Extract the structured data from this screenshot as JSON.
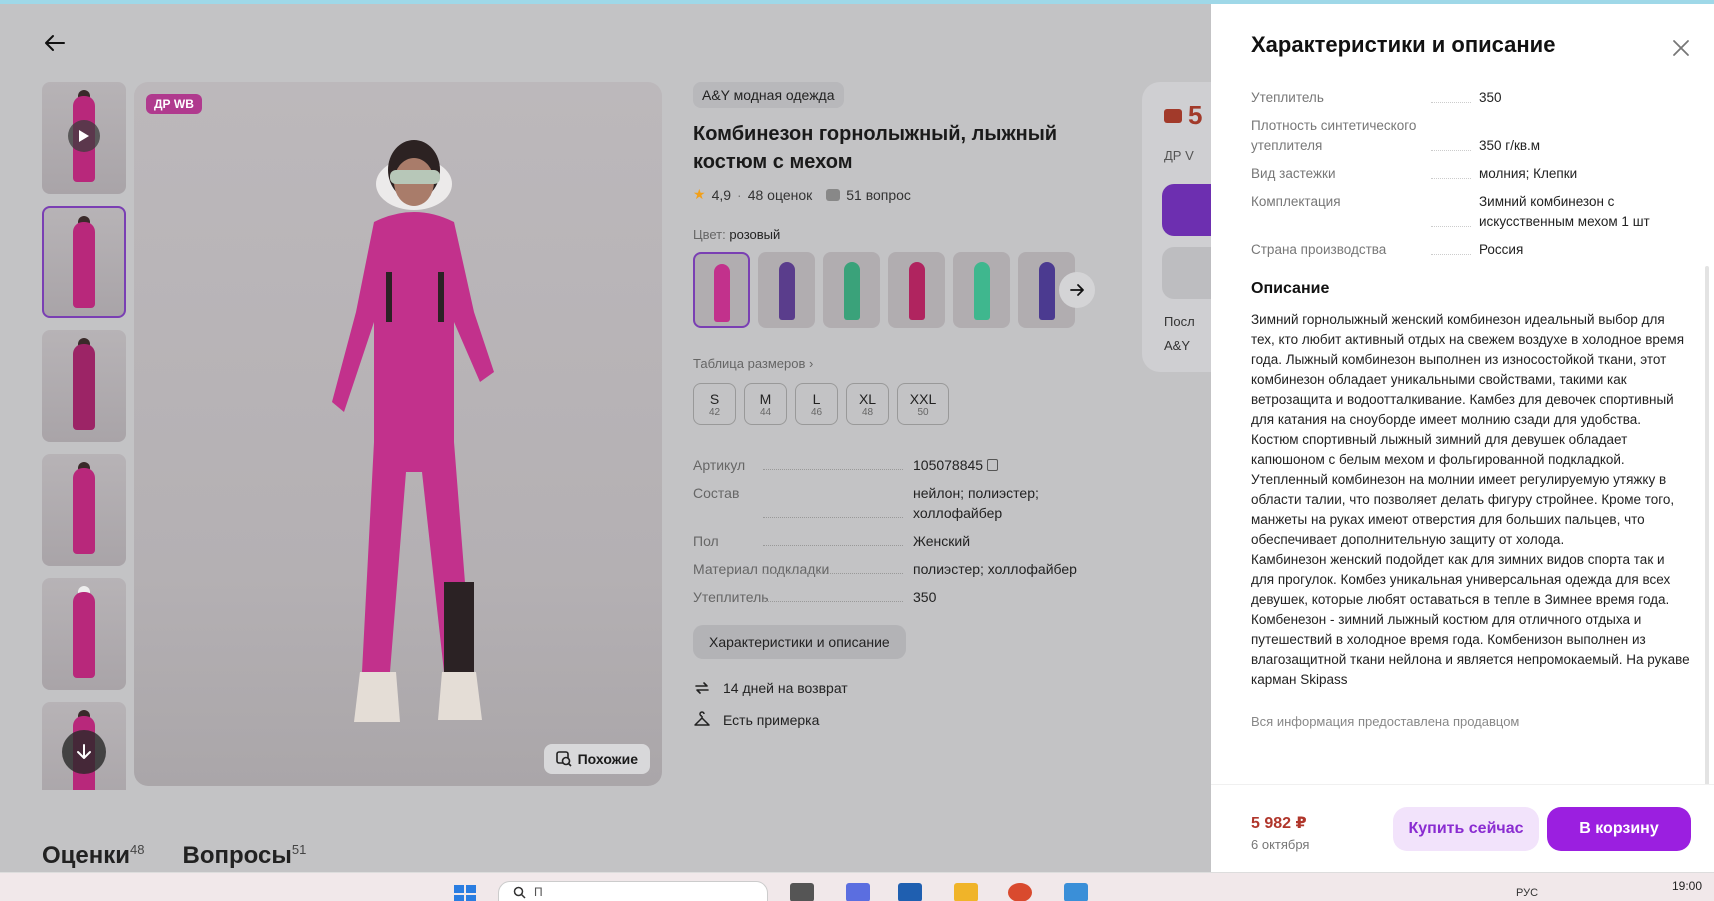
{
  "product": {
    "badge": "ДР WB",
    "similar_label": "Похожие",
    "brand": "A&Y модная одежда",
    "title": "Комбинезон горнолыжный, лыжный костюм с мехом",
    "rating": "4,9",
    "reviews": "48 оценок",
    "questions": "51 вопрос",
    "color_label": "Цвет:",
    "color_value": "розовый",
    "size_table_link": "Таблица размеров",
    "sizes": [
      {
        "name": "S",
        "ru": "42"
      },
      {
        "name": "M",
        "ru": "44"
      },
      {
        "name": "L",
        "ru": "46"
      },
      {
        "name": "XL",
        "ru": "48"
      },
      {
        "name": "XXL",
        "ru": "50"
      }
    ],
    "params": [
      {
        "key": "Артикул",
        "value": "105078845"
      },
      {
        "key": "Состав",
        "value": "нейлон; полиэстер; холлофайбер"
      },
      {
        "key": "Пол",
        "value": "Женский"
      },
      {
        "key": "Материал подкладки",
        "value": "полиэстер; холлофайбер"
      },
      {
        "key": "Утеплитель",
        "value": "350"
      }
    ],
    "chars_button": "Характеристики и описание",
    "features": [
      "14 дней на возврат",
      "Есть примерка"
    ],
    "buybox": {
      "price_partial": "5",
      "wb_partial": "ДР V",
      "line1": "Посл",
      "line2": "A&Y"
    }
  },
  "bottom_tabs": [
    {
      "label": "Оценки",
      "count": "48"
    },
    {
      "label": "Вопросы",
      "count": "51"
    }
  ],
  "drawer": {
    "title": "Характеристики и описание",
    "rows": [
      {
        "key": "Утеплитель",
        "value": "350"
      },
      {
        "key": "Плотность синтетического утеплителя",
        "value": "350 г/кв.м"
      },
      {
        "key": "Вид застежки",
        "value": "молния; Клепки"
      },
      {
        "key": "Комплектация",
        "value": "Зимний комбинезон с искусственным мехом 1 шт"
      },
      {
        "key": "Страна производства",
        "value": "Россия"
      }
    ],
    "desc_heading": "Описание",
    "description": "Зимний горнолыжный женский комбинезон идеальный выбор для тех, кто любит активный отдых на свежем воздухе в холодное время года. Лыжный комбинезон выполнен из износостойкой ткани, этот комбинезон обладает уникальными свойствами, такими как ветрозащита и водоотталкивание. Камбез для девочек спортивный для катания на сноуборде имеет молнию сзади для удобства. Костюм спортивный лыжный зимний для девушек обладает капюшоном с белым мехом и фольгированной подкладкой. Утепленный комбинезон на молнии имеет регулируемую утяжку в области талии, что позволяет делать фигуру стройнее. Кроме того, манжеты на руках имеют отверстия для больших пальцев, что обеспечивает дополнительную защиту от холода.\nКамбинезон женский подойдет как для зимних видов спорта так и для прогулок. Комбез уникальная универсальная одежда для всех девушек, которые любят оставаться в тепле в Зимнее время года. Комбенезон - зимний лыжный костюм для отличного отдыха и путешествий в холодное время года. Комбенизон выполнен из влагозащитной ткани нейлона и является непромокаемый. На рукаве карман Skipass",
    "note": "Вся информация предоставлена продавцом",
    "price": "5 982 ₽",
    "date": "6 октября",
    "buy_now": "Купить сейчас",
    "to_cart": "В корзину"
  },
  "taskbar": {
    "search_placeholder": "П",
    "lang": "РУС",
    "time": "19:00"
  },
  "colors": {
    "accent": "#9b1fe0",
    "price": "#b0362b",
    "jumpsuit": "#c8318f"
  },
  "icons": [
    "back-arrow-icon",
    "play-icon",
    "down-arrow-icon",
    "star-icon",
    "question-icon",
    "copy-icon",
    "right-arrow-icon",
    "return-icon",
    "hanger-icon",
    "similar-search-icon",
    "close-icon",
    "windows-icon",
    "search-icon"
  ]
}
